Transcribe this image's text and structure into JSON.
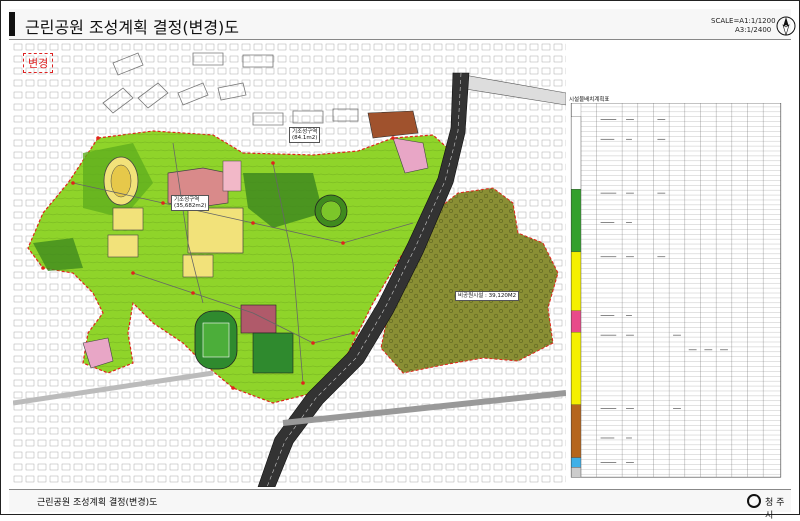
{
  "header": {
    "title": "근린공원 조성계획 결정(변경)도",
    "scale_a1": "SCALE=A1:1/1200",
    "scale_a3": "A3:1/2400"
  },
  "stamp": "변경",
  "map_labels": {
    "zone1_name": "기조성구역",
    "zone1_area": "(35,682m2)",
    "zone2_name": "기조성구역",
    "zone2_area": "(84.1m2)",
    "forest_label": "비공원시설 : 39,120M2"
  },
  "table": {
    "title": "시설물배치계획표"
  },
  "footer": {
    "title": "근린공원 조성계획 결정(변경)도",
    "city": "청 주 시"
  },
  "colors": {
    "park_green": "#8fd42a",
    "dark_green": "#3f8a1e",
    "forest_olive": "#8a8f34",
    "road_dark": "#333333",
    "boundary_red": "#e0241b",
    "sports_yellow": "#f2e27a"
  }
}
